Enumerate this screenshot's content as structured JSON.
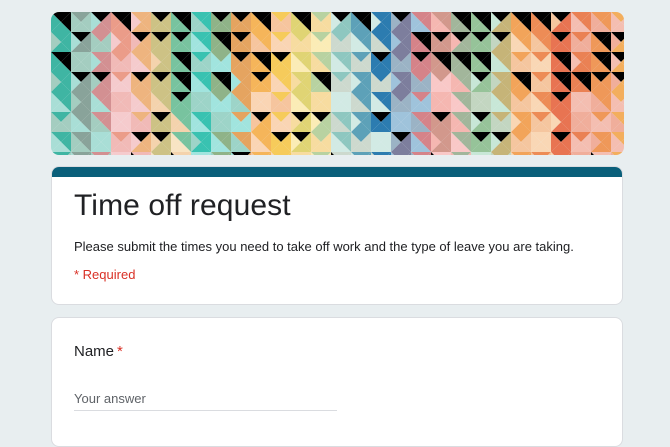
{
  "form": {
    "title": "Time off request",
    "description": "Please submit the times you need to take off work and the type of leave you are taking.",
    "required_note": "* Required",
    "accent_color": "#0a5f7a",
    "required_color": "#d93025"
  },
  "questions": [
    {
      "label": "Name",
      "required_mark": "*",
      "placeholder": "Your answer",
      "value": ""
    }
  ],
  "banner": {
    "icon": "geometric-pattern-header-image"
  }
}
